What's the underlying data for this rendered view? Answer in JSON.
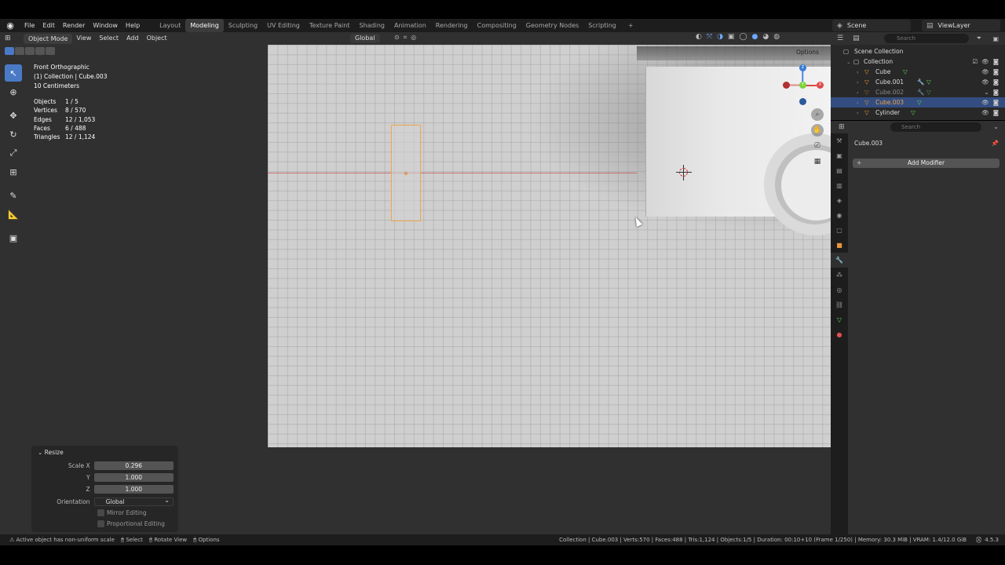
{
  "topbar": {
    "menu": [
      "File",
      "Edit",
      "Render",
      "Window",
      "Help"
    ],
    "workspaces": [
      "Layout",
      "Modeling",
      "Sculpting",
      "UV Editing",
      "Texture Paint",
      "Shading",
      "Animation",
      "Rendering",
      "Compositing",
      "Geometry Nodes",
      "Scripting"
    ],
    "active_workspace": "Modeling",
    "scene": "Scene",
    "view_layer": "ViewLayer"
  },
  "viewport_header": {
    "mode": "Object Mode",
    "menus": [
      "View",
      "Select",
      "Add",
      "Object"
    ],
    "orientation": "Global"
  },
  "overlay": {
    "view_name": "Front Orthographic",
    "collection": "(1) Collection | Cube.003",
    "scale": "10 Centimeters",
    "stats": [
      {
        "label": "Objects",
        "value": "1 / 5"
      },
      {
        "label": "Vertices",
        "value": "8 / 570"
      },
      {
        "label": "Edges",
        "value": "12 / 1,053"
      },
      {
        "label": "Faces",
        "value": "6 / 488"
      },
      {
        "label": "Triangles",
        "value": "12 / 1,124"
      }
    ],
    "options_label": "Options"
  },
  "operator_panel": {
    "title": "Resize",
    "scale_x_label": "Scale X",
    "scale_x": "0.296",
    "y_label": "Y",
    "y": "1.000",
    "z_label": "Z",
    "z": "1.000",
    "orientation_label": "Orientation",
    "orientation": "Global",
    "mirror": "Mirror Editing",
    "proportional": "Proportional Editing"
  },
  "outliner": {
    "search_placeholder": "Search",
    "root": "Scene Collection",
    "collection": "Collection",
    "items": [
      "Cube",
      "Cube.001",
      "Cube.002",
      "Cube.003",
      "Cylinder"
    ]
  },
  "properties": {
    "search_placeholder": "Search",
    "object_name": "Cube.003",
    "add_modifier": "Add Modifier"
  },
  "statusbar": {
    "message": "Active object has non-uniform scale",
    "select": "Select",
    "rotate": "Rotate View",
    "options": "Options",
    "info": "Collection | Cube.003 | Verts:570 | Faces:488 | Tris:1,124 | Objects:1/5 | Duration: 00:10+10 (Frame 1/250) | Memory: 30.3 MiB | VRAM: 1.4/12.0 GiB",
    "version": "4.5.3"
  },
  "colors": {
    "selection_outline": "#f0a54a",
    "active_blue": "#4a7ac6",
    "x_axis": "#c25858"
  }
}
